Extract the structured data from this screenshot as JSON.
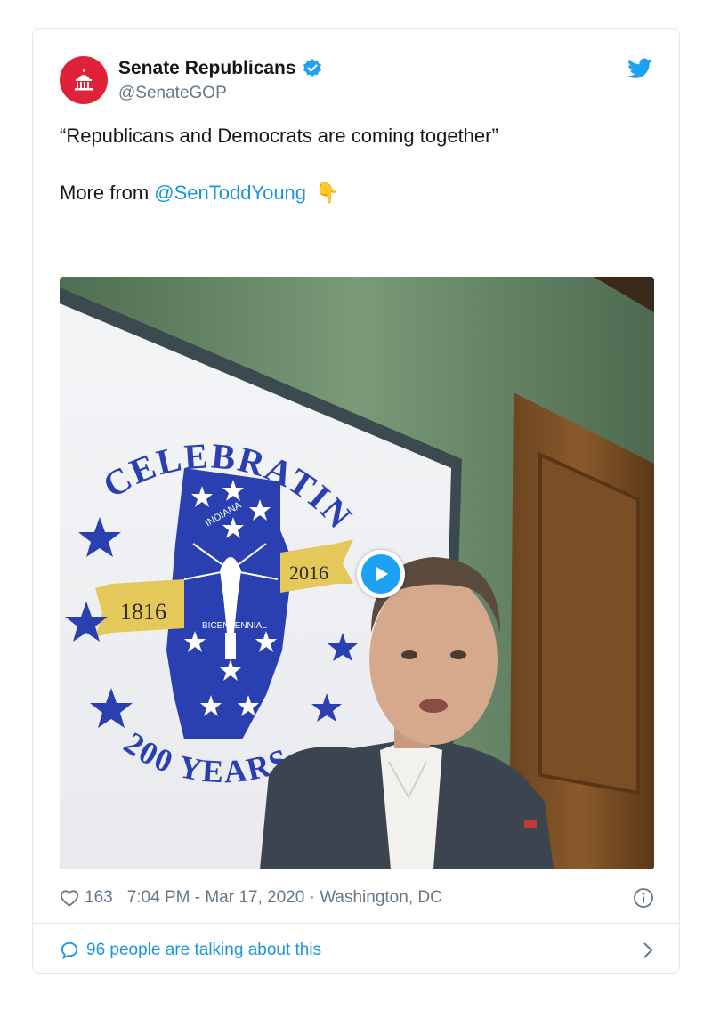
{
  "account": {
    "name": "Senate Republicans",
    "handle": "@SenateGOP"
  },
  "tweet": {
    "text_line1": "“Republicans and Democrats are coming together”",
    "text_prefix": "More from",
    "mention": "@SenToddYoung",
    "emoji": "👇"
  },
  "media": {
    "banner_arc_top": "CELEBRATING",
    "banner_arc_bottom": "200 YEARS",
    "year_left": "1816",
    "year_right": "2016",
    "state_label": "INDIANA",
    "state_sub": "BICENTENNIAL"
  },
  "meta": {
    "likes": "163",
    "timestamp": "7:04 PM - Mar 17, 2020 · Washington, DC"
  },
  "footer": {
    "talking": "96 people are talking about this"
  },
  "colors": {
    "brand_red": "#e0213a",
    "twitter_blue": "#1da1f2",
    "link_blue": "#1b95e0",
    "banner_blue": "#2a3fb0"
  }
}
